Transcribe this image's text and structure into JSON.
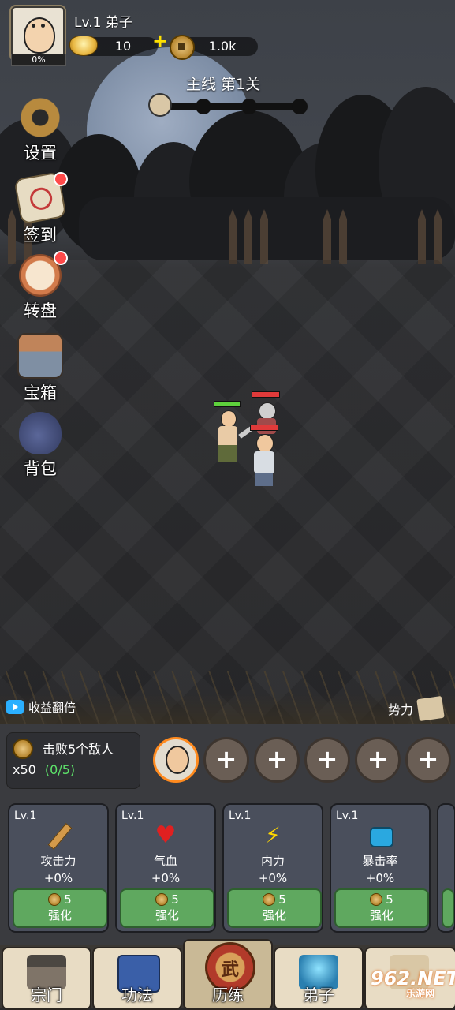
{
  "player": {
    "level": "Lv.1 弟子",
    "exp_percent": "0%",
    "ingot_count": "10",
    "coin_count": "1.0k",
    "plus_label": "+"
  },
  "stage": {
    "title": "主线 第1关"
  },
  "side_menu": [
    {
      "label": "设置",
      "icon": "gear-icon",
      "badge": false
    },
    {
      "label": "签到",
      "icon": "checkin-scroll-icon",
      "badge": true
    },
    {
      "label": "转盘",
      "icon": "wheel-icon",
      "badge": true
    },
    {
      "label": "宝箱",
      "icon": "chest-icon",
      "badge": false
    },
    {
      "label": "背包",
      "icon": "bag-icon",
      "badge": false
    }
  ],
  "battle_bar": {
    "double_label": "收益翻倍",
    "faction_label": "势力"
  },
  "task": {
    "text": "击败5个敌人",
    "reward": "x50",
    "progress": "(0/5)"
  },
  "team_slots": {
    "plus": "+"
  },
  "stats": [
    {
      "lv": "Lv.1",
      "name": "攻击力",
      "value": "+0%",
      "cost": "5",
      "button": "强化",
      "icon": "sword-icon",
      "color": "#c98a3a"
    },
    {
      "lv": "Lv.1",
      "name": "气血",
      "value": "+0%",
      "cost": "5",
      "button": "强化",
      "icon": "heart-icon",
      "color": "#e02020"
    },
    {
      "lv": "Lv.1",
      "name": "内力",
      "value": "+0%",
      "cost": "5",
      "button": "强化",
      "icon": "lightning-icon",
      "color": "#ffd700"
    },
    {
      "lv": "Lv.1",
      "name": "暴击率",
      "value": "+0%",
      "cost": "5",
      "button": "强化",
      "icon": "fist-icon",
      "color": "#2aa8e0"
    }
  ],
  "nav": {
    "tabs": [
      "宗门",
      "功法",
      "历练",
      "弟子",
      ""
    ],
    "active_badge": "武"
  },
  "watermark": {
    "brand": "962.NET",
    "sub": "乐游网"
  }
}
